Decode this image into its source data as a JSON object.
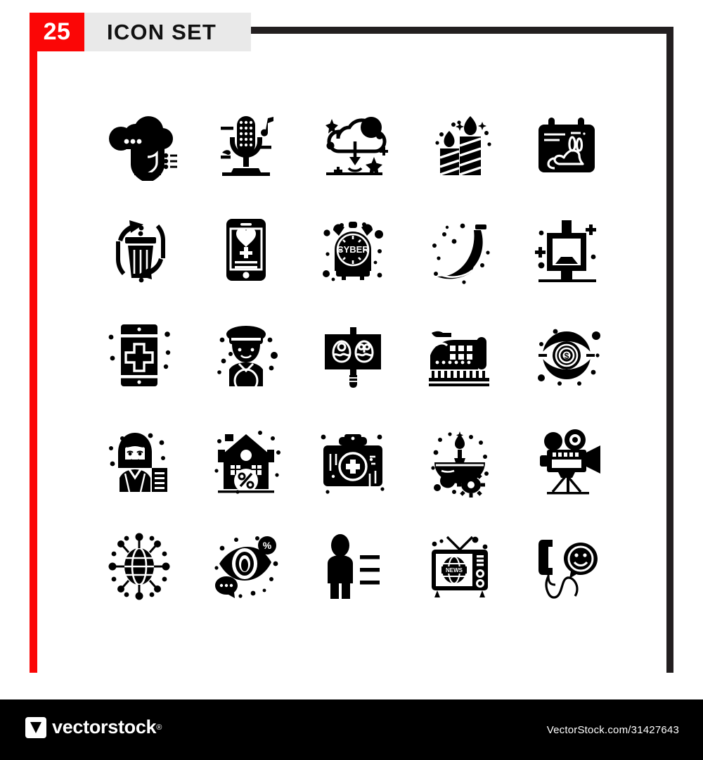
{
  "header": {
    "count_badge": "25",
    "title": "ICON SET",
    "badge_color": "#fb0606",
    "title_bg_color": "#e9e9e9",
    "frame_color": "#231f20"
  },
  "footer": {
    "brand": "vectorstock",
    "registered_mark": "®",
    "url": "VectorStock.com/31427643",
    "bg_color": "#000000",
    "text_color": "#ffffff"
  },
  "grid": {
    "columns": 5,
    "rows": 5,
    "total": 25
  },
  "icons": [
    {
      "index": 1,
      "name": "cloud-shield-icon",
      "label": "Cloud Security"
    },
    {
      "index": 2,
      "name": "microphone-music-icon",
      "label": "Podcast Microphone"
    },
    {
      "index": 3,
      "name": "cloud-download-icon",
      "label": "Cloud Download"
    },
    {
      "index": 4,
      "name": "birthday-candles-icon",
      "label": "Birthday Candles"
    },
    {
      "index": 5,
      "name": "easter-calendar-icon",
      "label": "Easter Calendar"
    },
    {
      "index": 6,
      "name": "recycle-bin-icon",
      "label": "Recycle Bin"
    },
    {
      "index": 7,
      "name": "mobile-heart-icon",
      "label": "Mobile Dating App"
    },
    {
      "index": 8,
      "name": "cyber-alarm-clock-icon",
      "label": "Cyber Monday Clock",
      "text": "CYBER"
    },
    {
      "index": 9,
      "name": "banana-icon",
      "label": "Banana"
    },
    {
      "index": 10,
      "name": "gift-display-icon",
      "label": "Gift Display Stand"
    },
    {
      "index": 11,
      "name": "mobile-medical-icon",
      "label": "Medical App"
    },
    {
      "index": 12,
      "name": "police-officer-icon",
      "label": "Police Officer"
    },
    {
      "index": 13,
      "name": "easter-egg-billboard-icon",
      "label": "Easter Egg Sign"
    },
    {
      "index": 14,
      "name": "cruise-ship-icon",
      "label": "Cruise Ship"
    },
    {
      "index": 15,
      "name": "eye-dollar-icon",
      "label": "Money Vision"
    },
    {
      "index": 16,
      "name": "businesswoman-icon",
      "label": "Businesswoman"
    },
    {
      "index": 17,
      "name": "house-discount-icon",
      "label": "House Discount"
    },
    {
      "index": 18,
      "name": "first-aid-kit-icon",
      "label": "First Aid Kit"
    },
    {
      "index": 19,
      "name": "diya-lamp-icon",
      "label": "Diya Oil Lamp"
    },
    {
      "index": 20,
      "name": "film-camera-icon",
      "label": "Film Camera"
    },
    {
      "index": 21,
      "name": "global-network-icon",
      "label": "Global Network"
    },
    {
      "index": 22,
      "name": "eye-discount-chat-icon",
      "label": "Discount Vision"
    },
    {
      "index": 23,
      "name": "person-list-icon",
      "label": "User Profile List"
    },
    {
      "index": 24,
      "name": "news-television-icon",
      "label": "News Television",
      "text": "NEWS"
    },
    {
      "index": 25,
      "name": "phone-smiley-icon",
      "label": "Customer Support"
    }
  ]
}
